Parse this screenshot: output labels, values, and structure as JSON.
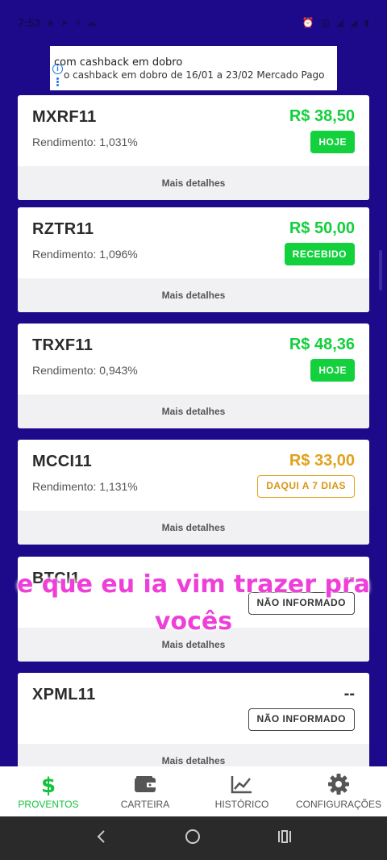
{
  "status_bar": {
    "time": "7:53"
  },
  "ad": {
    "line1": "com cashback em dobro",
    "line2": "o cashback em dobro de 16/01 a 23/02 Mercado Pago"
  },
  "cards": [
    {
      "ticker": "MXRF11",
      "yield": "Rendimento: 1,031%",
      "value": "R$ 38,50",
      "badge": "HOJE",
      "details": "Mais detalhes"
    },
    {
      "ticker": "RZTR11",
      "yield": "Rendimento: 1,096%",
      "value": "R$ 50,00",
      "badge": "RECEBIDO",
      "details": "Mais detalhes"
    },
    {
      "ticker": "TRXF11",
      "yield": "Rendimento: 0,943%",
      "value": "R$ 48,36",
      "badge": "HOJE",
      "details": "Mais detalhes"
    },
    {
      "ticker": "MCCI11",
      "yield": "Rendimento: 1,131%",
      "value": "R$ 33,00",
      "badge": "DAQUI A 7 DIAS",
      "details": "Mais detalhes"
    },
    {
      "ticker": "BTCI1",
      "yield": "",
      "value": "--",
      "badge": "NÃO INFORMADO",
      "details": "Mais detalhes"
    },
    {
      "ticker": "XPML11",
      "yield": "",
      "value": "--",
      "badge": "NÃO INFORMADO",
      "details": "Mais detalhes"
    }
  ],
  "caption": {
    "line1": "e que eu ia vim trazer pra",
    "line2": "vocês"
  },
  "bottom_nav": [
    {
      "label": "PROVENTOS",
      "icon": "dollar-icon"
    },
    {
      "label": "CARTEIRA",
      "icon": "wallet-icon"
    },
    {
      "label": "HISTÓRICO",
      "icon": "chart-line-icon"
    },
    {
      "label": "CONFIGURAÇÕES",
      "icon": "gear-icon"
    }
  ],
  "colors": {
    "background": "#1d0a8a",
    "green": "#12cf3a",
    "orange": "#e0a21b",
    "caption": "#ee3fd9"
  }
}
